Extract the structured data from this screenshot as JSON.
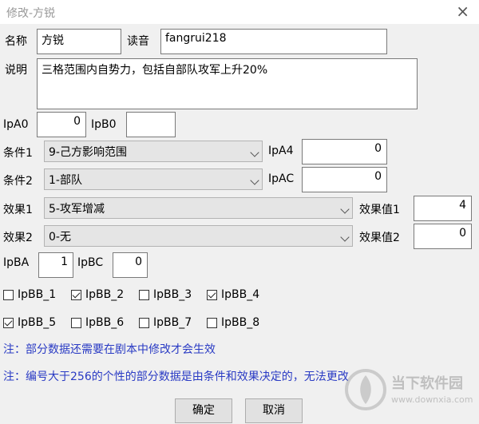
{
  "window": {
    "title": "修改-方锐",
    "close_glyph": "×"
  },
  "fields": {
    "name_label": "名称",
    "name_value": "方锐",
    "reading_label": "读音",
    "reading_value": "fangrui218",
    "desc_label": "说明",
    "desc_value": "三格范围内自势力，包括自部队攻军上升20%",
    "ipa0_label": "IpA0",
    "ipa0_value": "0",
    "ipb0_label": "IpB0",
    "ipb0_value": "",
    "cond1_label": "条件1",
    "cond1_value": "9-己方影响范围",
    "ipa4_label": "IpA4",
    "ipa4_value": "0",
    "cond2_label": "条件2",
    "cond2_value": "1-部队",
    "ipac_label": "IpAC",
    "ipac_value": "0",
    "effect1_label": "效果1",
    "effect1_value": "5-攻军增减",
    "effectval1_label": "效果值1",
    "effectval1_value": "4",
    "effect2_label": "效果2",
    "effect2_value": "0-无",
    "effectval2_label": "效果值2",
    "effectval2_value": "0",
    "ipba_label": "IpBA",
    "ipba_value": "1",
    "ipbc_label": "IpBC",
    "ipbc_value": "0"
  },
  "checkboxes": [
    {
      "label": "IpBB_1",
      "checked": false
    },
    {
      "label": "IpBB_2",
      "checked": true
    },
    {
      "label": "IpBB_3",
      "checked": false
    },
    {
      "label": "IpBB_4",
      "checked": true
    },
    {
      "label": "IpBB_5",
      "checked": true
    },
    {
      "label": "IpBB_6",
      "checked": false
    },
    {
      "label": "IpBB_7",
      "checked": false
    },
    {
      "label": "IpBB_8",
      "checked": false
    }
  ],
  "notes": {
    "note1": "注：部分数据还需要在剧本中修改才会生效",
    "note2": "注：编号大于256的个性的部分数据是由条件和效果决定的，无法更改"
  },
  "buttons": {
    "ok": "确定",
    "cancel": "取消"
  },
  "watermark": {
    "brand": "当下软件园",
    "url": "www.downxia.com"
  }
}
